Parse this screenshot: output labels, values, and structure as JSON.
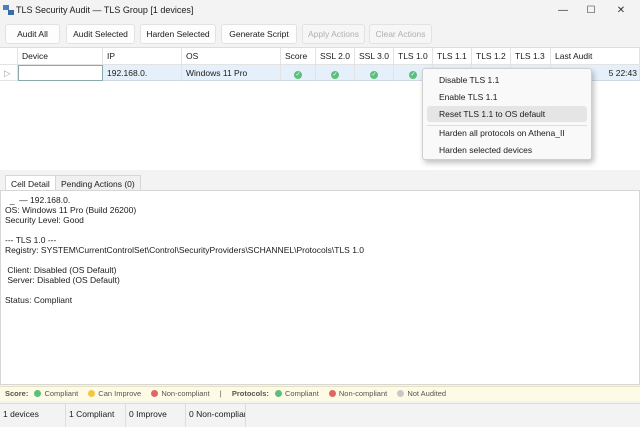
{
  "window": {
    "title": "TLS Security Audit — TLS Group [1 devices]",
    "minimize": "—",
    "maximize": "☐",
    "close": "✕"
  },
  "toolbar": {
    "audit_all": "Audit All",
    "audit_selected": "Audit Selected",
    "harden_selected": "Harden Selected",
    "generate_script": "Generate Script",
    "apply_actions": "Apply Actions",
    "clear_actions": "Clear Actions"
  },
  "grid": {
    "columns": [
      "Device",
      "IP",
      "OS",
      "Score",
      "SSL 2.0",
      "SSL 3.0",
      "TLS 1.0",
      "TLS 1.1",
      "TLS 1.2",
      "TLS 1.3",
      "Last Audit"
    ],
    "row": {
      "device": "",
      "ip": "192.168.0.",
      "os": "Windows 11 Pro",
      "score": "compliant",
      "ssl20": "compliant",
      "ssl30": "compliant",
      "tls10": "compliant",
      "last_audit": "5 22:43"
    }
  },
  "context_menu": {
    "items": [
      "Disable TLS 1.1",
      "Enable TLS 1.1",
      "Reset TLS 1.1 to OS default",
      "Harden all protocols on Athena_II",
      "Harden selected devices"
    ],
    "highlighted": 2
  },
  "tabs": [
    "Cell Detail",
    "Pending Actions (0)"
  ],
  "detail": {
    "lines": [
      "  _  — 192.168.0.",
      "OS: Windows 11 Pro (Build 26200)",
      "Security Level: Good",
      "",
      "--- TLS 1.0 ---",
      "Registry: SYSTEM\\CurrentControlSet\\Control\\SecurityProviders\\SCHANNEL\\Protocols\\TLS 1.0",
      "",
      " Client: Disabled (OS Default)",
      " Server: Disabled (OS Default)",
      "",
      "Status: Compliant"
    ]
  },
  "legend": {
    "score_label": "Score:",
    "compliant": "Compliant",
    "can_improve": "Can Improve",
    "non_compliant": "Non-compliant",
    "sep": "|",
    "protocols_label": "Protocols:",
    "p_compliant": "Compliant",
    "p_non_compliant": "Non-compliant",
    "not_audited": "Not Audited"
  },
  "colors": {
    "compliant": "#5cc07a",
    "improve": "#f2c744",
    "non_compliant": "#e06666",
    "not_audited": "#c8c8c8",
    "selection": "#e6f0fa"
  },
  "status": {
    "devices": "1 devices",
    "compliant": "1 Compliant",
    "improve": "0 Improve",
    "non_compliant": "0 Non-complian"
  }
}
